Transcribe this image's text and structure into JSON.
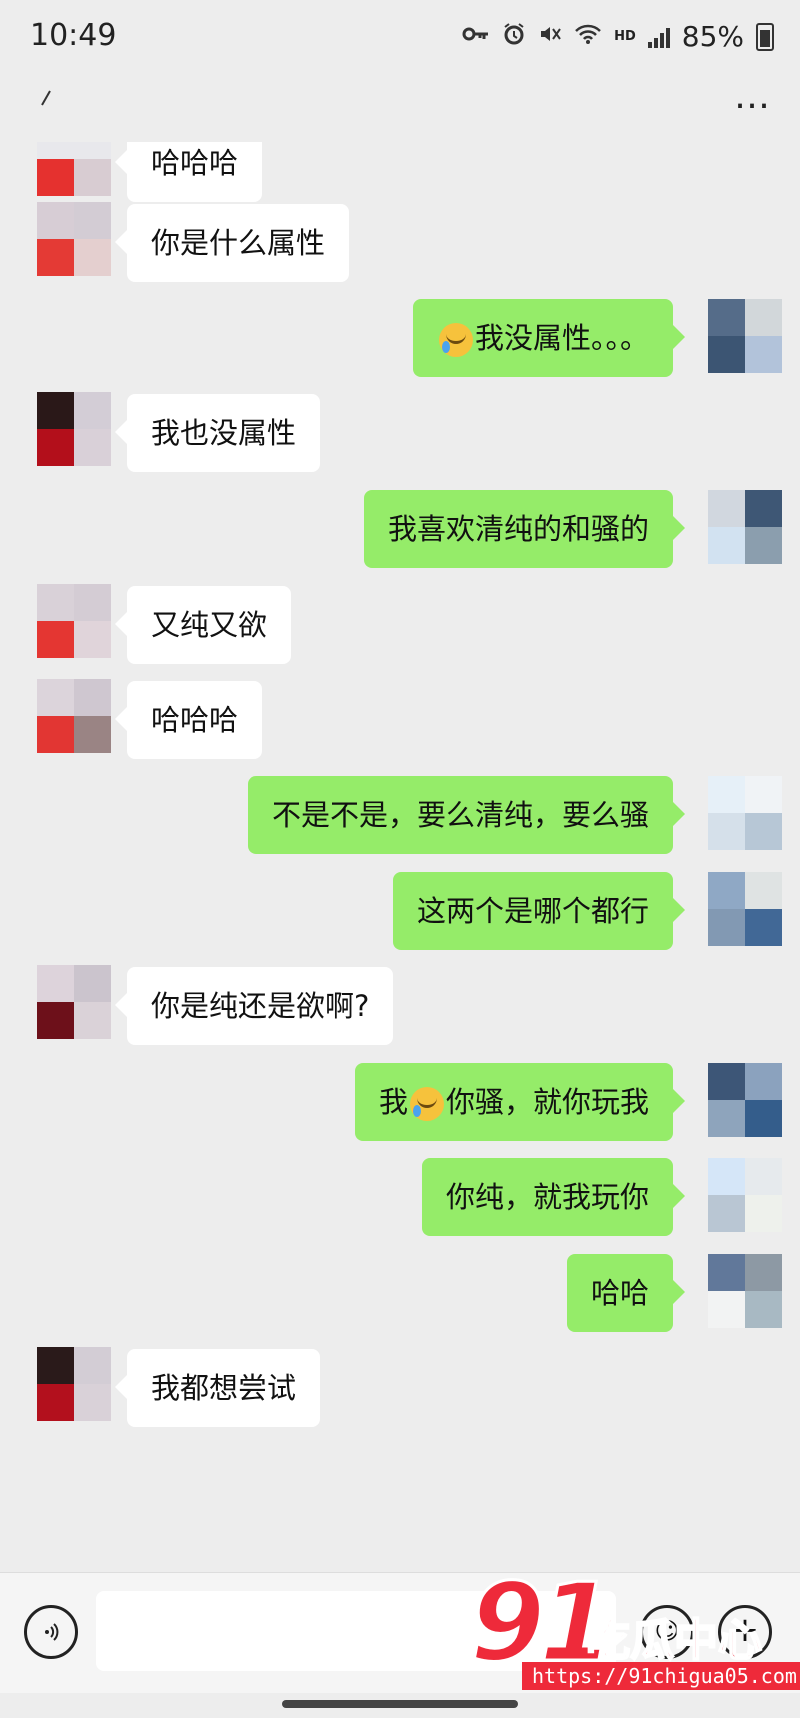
{
  "status_bar": {
    "time": "10:49",
    "battery": "85%",
    "network_label": "HD",
    "icons": [
      "key-icon",
      "alarm-icon",
      "mute-icon",
      "wifi-icon",
      "signal-icon",
      "battery-icon"
    ]
  },
  "nav": {
    "back_icon": "back-arrow-icon",
    "title": "",
    "more_label": "…"
  },
  "messages": [
    {
      "side": "left",
      "text": "哈哈哈",
      "avatar": [
        "#e8e8ec",
        "#e8e8ec",
        "#e5312f",
        "#d8ccd2"
      ]
    },
    {
      "side": "left",
      "text": "你是什么属性",
      "avatar": [
        "#d7cdd5",
        "#d3ccd4",
        "#e43a35",
        "#e4cfcf"
      ]
    },
    {
      "side": "right",
      "text": "我没属性。。。",
      "emoji_before": true,
      "avatar": [
        "#556c89",
        "#d2d7da",
        "#3c5573",
        "#b2c3da"
      ]
    },
    {
      "side": "left",
      "text": "我也没属性",
      "avatar": [
        "#2a1818",
        "#d3cdd6",
        "#b30f1b",
        "#d9d0d8"
      ]
    },
    {
      "side": "right",
      "text": "我喜欢清纯的和骚的",
      "avatar": [
        "#d1d7df",
        "#3e5775",
        "#d2e2f1",
        "#8b9eae"
      ]
    },
    {
      "side": "left",
      "text": "又纯又欲",
      "avatar": [
        "#d9d1d8",
        "#d4ccd4",
        "#e43632",
        "#e0d4da"
      ]
    },
    {
      "side": "left",
      "text": "哈哈哈",
      "avatar": [
        "#dcd4db",
        "#cfc7d0",
        "#e23633",
        "#9a8484"
      ]
    },
    {
      "side": "right",
      "text": "不是不是，要么清纯，要么骚",
      "avatar": [
        "#e6f0f8",
        "#f0f3f6",
        "#d5e0ea",
        "#b7c7d6"
      ]
    },
    {
      "side": "right",
      "text": "这两个是哪个都行",
      "avatar": [
        "#8fa8c5",
        "#dfe3e3",
        "#8299b3",
        "#416896"
      ]
    },
    {
      "side": "left",
      "text": "你是纯还是欲啊?",
      "avatar": [
        "#ddd3db",
        "#cbc4cd",
        "#6d101a",
        "#dad2d8"
      ]
    },
    {
      "side": "right",
      "text_before": "我",
      "text": "你骚，就你玩我",
      "emoji_mid": true,
      "avatar": [
        "#3d5677",
        "#8ba2be",
        "#8ea4bc",
        "#345d8b"
      ]
    },
    {
      "side": "right",
      "text": "你纯，就我玩你",
      "avatar": [
        "#d5e6f8",
        "#e6eaed",
        "#b9c6d3",
        "#eef1ec"
      ]
    },
    {
      "side": "right",
      "text": "哈哈",
      "avatar": [
        "#61789a",
        "#8d99a4",
        "#f2f3f3",
        "#a8b9c3"
      ]
    },
    {
      "side": "left",
      "text": "我都想尝试",
      "avatar": [
        "#2a1a1a",
        "#d3cdd5",
        "#b3101d",
        "#d9d1d8"
      ]
    }
  ],
  "input_bar": {
    "voice_icon": "voice-icon",
    "input_value": "",
    "emoji_icon": "emoji-icon",
    "plus_icon": "plus-icon"
  },
  "watermark": {
    "number": "91",
    "text": "吃瓜中心",
    "url": "https://91chigua05.com",
    "color": "#ee2a3a"
  }
}
